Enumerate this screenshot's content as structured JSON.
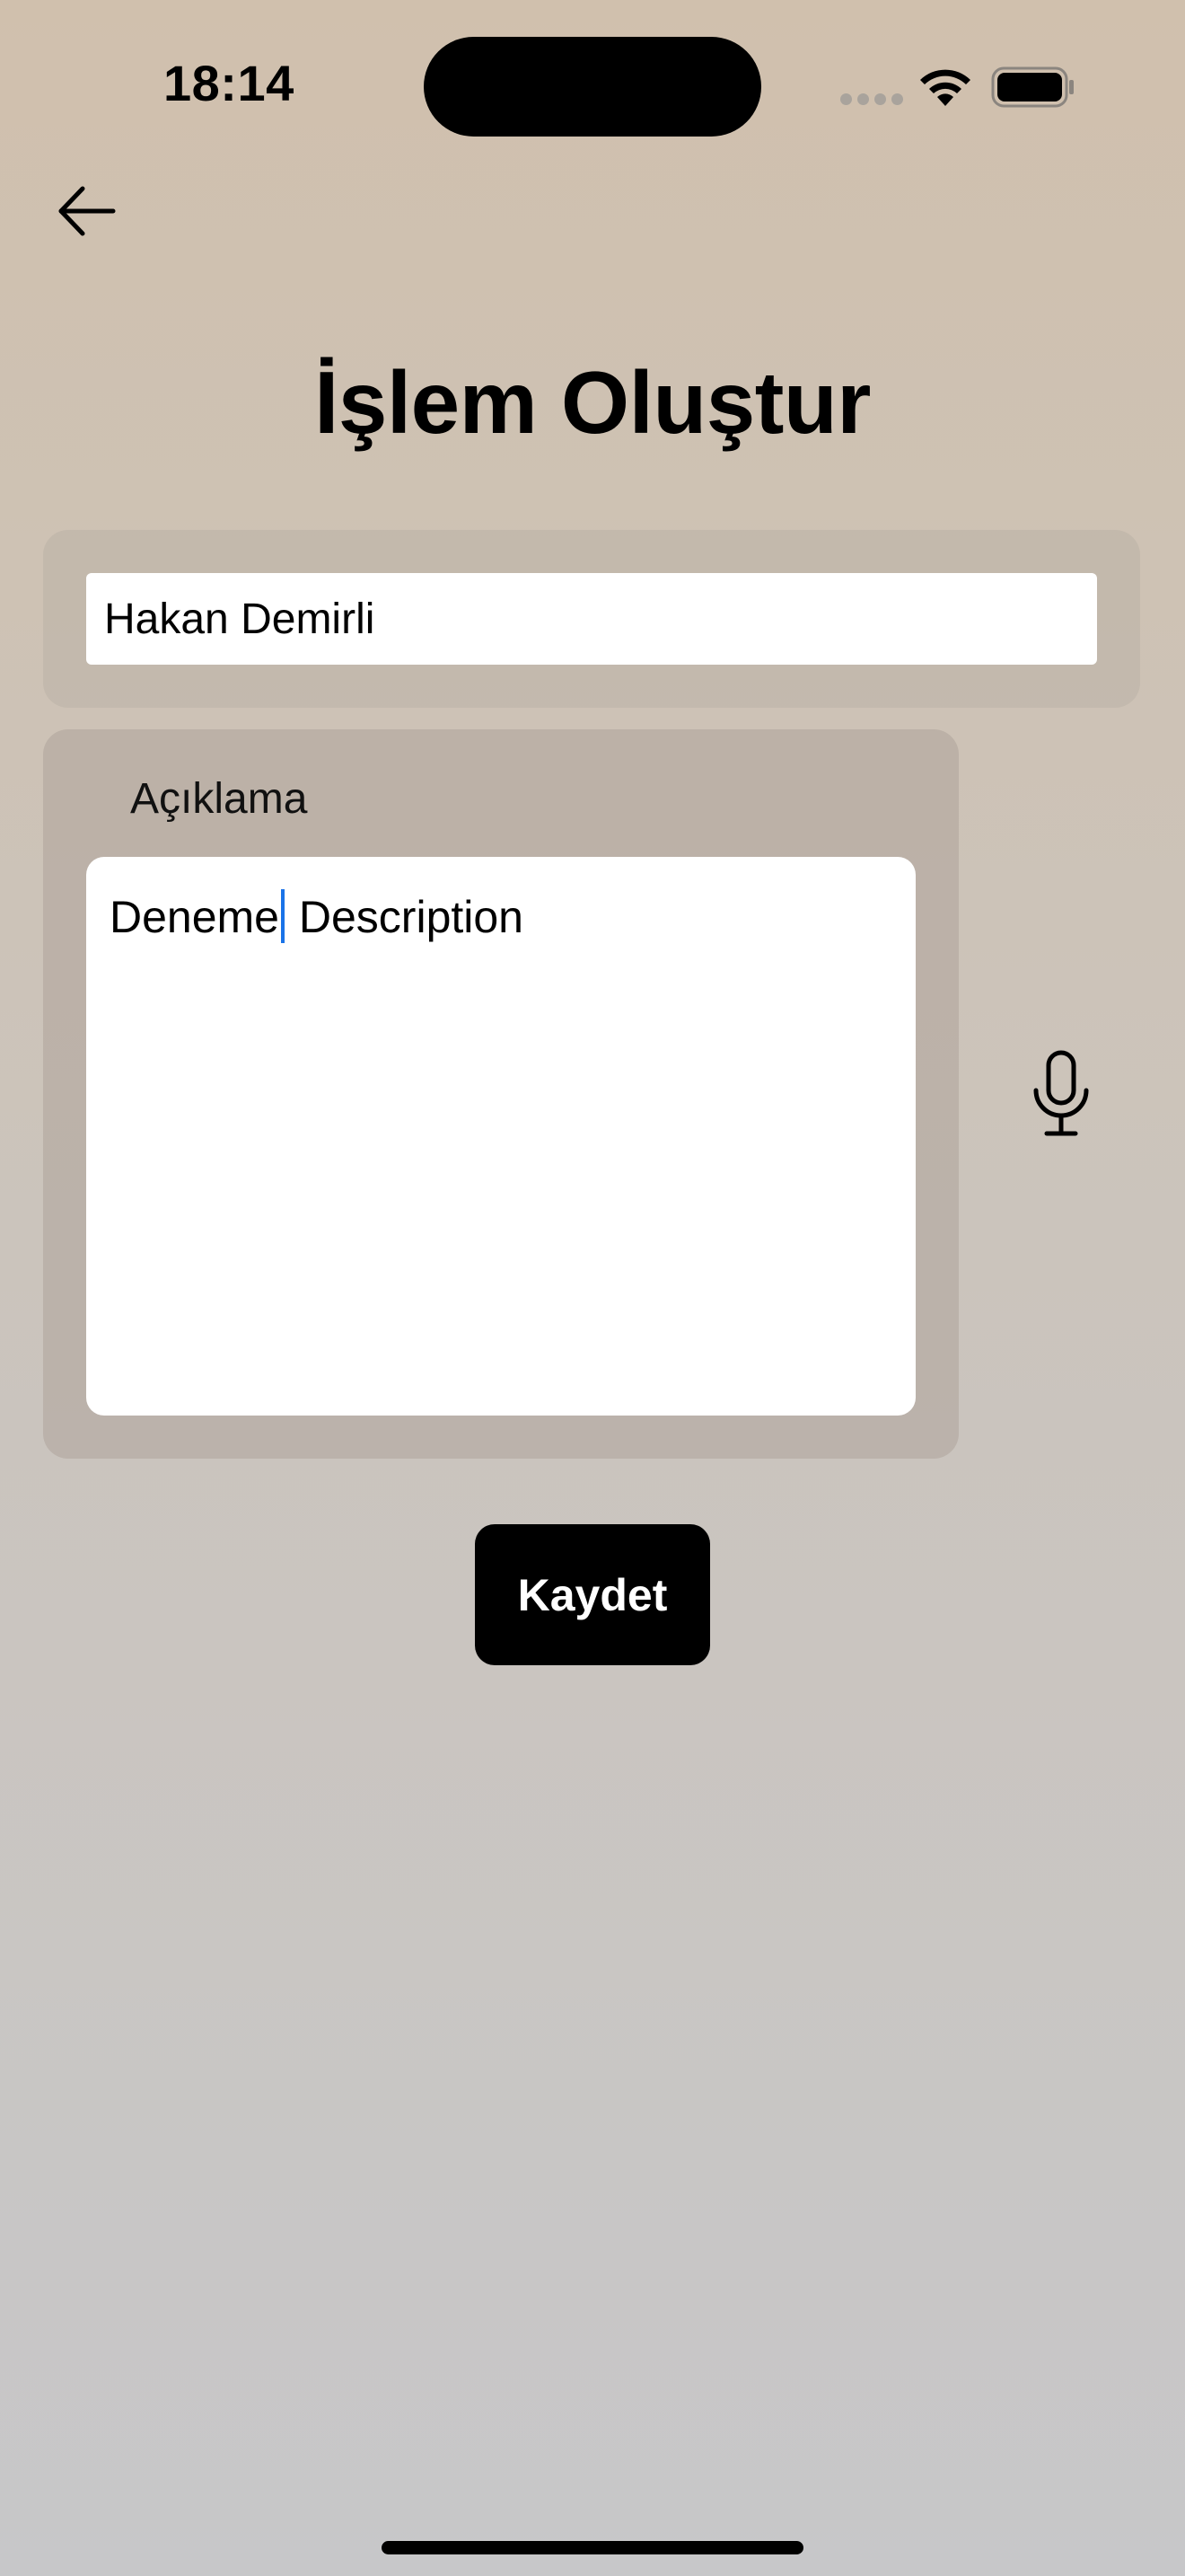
{
  "status_bar": {
    "time": "18:14",
    "icons": [
      "signal-dots-icon",
      "wifi-icon",
      "battery-icon"
    ]
  },
  "header": {
    "back_icon": "arrow-left-icon",
    "title": "İşlem Oluştur"
  },
  "form": {
    "name_value": "Hakan Demirli",
    "description_label": "Açıklama",
    "description_before_cursor": "Deneme",
    "description_after_cursor": " Description",
    "mic_icon": "microphone-icon",
    "save_label": "Kaydet"
  },
  "colors": {
    "background_top": "#d0c0ad",
    "background_bottom": "#c7c7c9",
    "button": "#000000",
    "caret": "#1a73e8"
  }
}
